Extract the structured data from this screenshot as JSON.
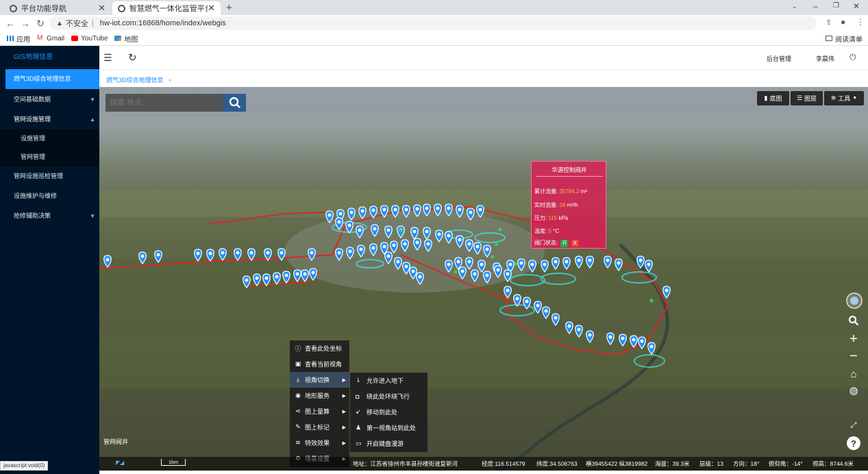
{
  "browser": {
    "tabs": [
      {
        "title": "平台功能导航"
      },
      {
        "title": "智慧燃气一体化监管平台| webGi"
      }
    ],
    "security_label": "不安全",
    "url": "hw-iot.com:16868/home/index/webgis",
    "bookmarks": [
      "应用",
      "Gmail",
      "YouTube",
      "地图"
    ],
    "reading_list": "阅读清单"
  },
  "sidebar": {
    "logo": "GIS地理信息",
    "items": [
      {
        "label": "燃气3D综合地理信息",
        "active": true
      },
      {
        "label": "空间基础数据"
      },
      {
        "label": "管网设施管理"
      },
      {
        "label": "设施管理"
      },
      {
        "label": "管网管理"
      },
      {
        "label": "管网设施巡检管理"
      },
      {
        "label": "设施维护与维修"
      },
      {
        "label": "抢修辅助决策"
      }
    ]
  },
  "header": {
    "admin": "后台管理",
    "user": "李晨伟"
  },
  "page_tab": "燃气3D综合地理信息",
  "map": {
    "search_placeholder": "搜索 地点",
    "basemap_label": "底图",
    "layers_label": "图层",
    "tools_label": "工具",
    "popup": {
      "title": "华源控制阀井",
      "cum_flow_label": "累计流量:",
      "cum_flow_value": "35784.2",
      "cum_flow_unit": "m³",
      "rt_flow_label": "实时流量:",
      "rt_flow_value": "28",
      "rt_flow_unit": "m³/h",
      "pressure_label": "压力:",
      "pressure_value": "115",
      "pressure_unit": "kPa",
      "temp_label": "温度:",
      "temp_value": "5",
      "temp_unit": "°C",
      "valve_label": "阀门状态:",
      "valve_open": "开",
      "valve_close": "关"
    },
    "context_menu": [
      {
        "label": "查看此处坐标"
      },
      {
        "label": "查看当前视角"
      },
      {
        "label": "视角切换",
        "has_sub": true
      },
      {
        "label": "地形服务",
        "has_sub": true
      },
      {
        "label": "图上量算",
        "has_sub": true
      },
      {
        "label": "图上标记",
        "has_sub": true
      },
      {
        "label": "特效效果",
        "has_sub": true
      },
      {
        "label": "场景设置",
        "has_sub": true
      }
    ],
    "sub_menu": [
      {
        "label": "允许进入地下"
      },
      {
        "label": "绕此处环绕飞行"
      },
      {
        "label": "移动到此处"
      },
      {
        "label": "第一视角站到此处"
      },
      {
        "label": "开启键盘漫游"
      }
    ],
    "layer_caption": "管网阀井",
    "scale": "1km",
    "status": {
      "address": "地址：江苏省徐州市丰县孙楼街道复新河",
      "lon": "经度:116.514579",
      "lat": "纬度:34.506763",
      "xy": "横39455422 纵3819982",
      "alt": "海拔：39.3米",
      "level": "层级：13",
      "heading": "方向：18°",
      "pitch": "俯仰角：-14°",
      "view_height": "视高：8744.6米"
    }
  },
  "js_status": "javascript:void(0)"
}
